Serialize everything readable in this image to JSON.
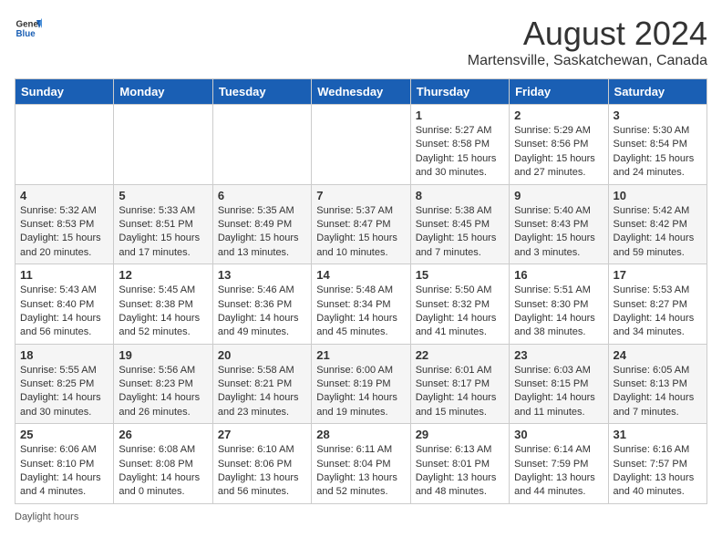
{
  "header": {
    "logo_general": "General",
    "logo_blue": "Blue",
    "month": "August 2024",
    "location": "Martensville, Saskatchewan, Canada"
  },
  "days_of_week": [
    "Sunday",
    "Monday",
    "Tuesday",
    "Wednesday",
    "Thursday",
    "Friday",
    "Saturday"
  ],
  "weeks": [
    [
      {
        "day": "",
        "info": ""
      },
      {
        "day": "",
        "info": ""
      },
      {
        "day": "",
        "info": ""
      },
      {
        "day": "",
        "info": ""
      },
      {
        "day": "1",
        "info": "Sunrise: 5:27 AM\nSunset: 8:58 PM\nDaylight: 15 hours and 30 minutes."
      },
      {
        "day": "2",
        "info": "Sunrise: 5:29 AM\nSunset: 8:56 PM\nDaylight: 15 hours and 27 minutes."
      },
      {
        "day": "3",
        "info": "Sunrise: 5:30 AM\nSunset: 8:54 PM\nDaylight: 15 hours and 24 minutes."
      }
    ],
    [
      {
        "day": "4",
        "info": "Sunrise: 5:32 AM\nSunset: 8:53 PM\nDaylight: 15 hours and 20 minutes."
      },
      {
        "day": "5",
        "info": "Sunrise: 5:33 AM\nSunset: 8:51 PM\nDaylight: 15 hours and 17 minutes."
      },
      {
        "day": "6",
        "info": "Sunrise: 5:35 AM\nSunset: 8:49 PM\nDaylight: 15 hours and 13 minutes."
      },
      {
        "day": "7",
        "info": "Sunrise: 5:37 AM\nSunset: 8:47 PM\nDaylight: 15 hours and 10 minutes."
      },
      {
        "day": "8",
        "info": "Sunrise: 5:38 AM\nSunset: 8:45 PM\nDaylight: 15 hours and 7 minutes."
      },
      {
        "day": "9",
        "info": "Sunrise: 5:40 AM\nSunset: 8:43 PM\nDaylight: 15 hours and 3 minutes."
      },
      {
        "day": "10",
        "info": "Sunrise: 5:42 AM\nSunset: 8:42 PM\nDaylight: 14 hours and 59 minutes."
      }
    ],
    [
      {
        "day": "11",
        "info": "Sunrise: 5:43 AM\nSunset: 8:40 PM\nDaylight: 14 hours and 56 minutes."
      },
      {
        "day": "12",
        "info": "Sunrise: 5:45 AM\nSunset: 8:38 PM\nDaylight: 14 hours and 52 minutes."
      },
      {
        "day": "13",
        "info": "Sunrise: 5:46 AM\nSunset: 8:36 PM\nDaylight: 14 hours and 49 minutes."
      },
      {
        "day": "14",
        "info": "Sunrise: 5:48 AM\nSunset: 8:34 PM\nDaylight: 14 hours and 45 minutes."
      },
      {
        "day": "15",
        "info": "Sunrise: 5:50 AM\nSunset: 8:32 PM\nDaylight: 14 hours and 41 minutes."
      },
      {
        "day": "16",
        "info": "Sunrise: 5:51 AM\nSunset: 8:30 PM\nDaylight: 14 hours and 38 minutes."
      },
      {
        "day": "17",
        "info": "Sunrise: 5:53 AM\nSunset: 8:27 PM\nDaylight: 14 hours and 34 minutes."
      }
    ],
    [
      {
        "day": "18",
        "info": "Sunrise: 5:55 AM\nSunset: 8:25 PM\nDaylight: 14 hours and 30 minutes."
      },
      {
        "day": "19",
        "info": "Sunrise: 5:56 AM\nSunset: 8:23 PM\nDaylight: 14 hours and 26 minutes."
      },
      {
        "day": "20",
        "info": "Sunrise: 5:58 AM\nSunset: 8:21 PM\nDaylight: 14 hours and 23 minutes."
      },
      {
        "day": "21",
        "info": "Sunrise: 6:00 AM\nSunset: 8:19 PM\nDaylight: 14 hours and 19 minutes."
      },
      {
        "day": "22",
        "info": "Sunrise: 6:01 AM\nSunset: 8:17 PM\nDaylight: 14 hours and 15 minutes."
      },
      {
        "day": "23",
        "info": "Sunrise: 6:03 AM\nSunset: 8:15 PM\nDaylight: 14 hours and 11 minutes."
      },
      {
        "day": "24",
        "info": "Sunrise: 6:05 AM\nSunset: 8:13 PM\nDaylight: 14 hours and 7 minutes."
      }
    ],
    [
      {
        "day": "25",
        "info": "Sunrise: 6:06 AM\nSunset: 8:10 PM\nDaylight: 14 hours and 4 minutes."
      },
      {
        "day": "26",
        "info": "Sunrise: 6:08 AM\nSunset: 8:08 PM\nDaylight: 14 hours and 0 minutes."
      },
      {
        "day": "27",
        "info": "Sunrise: 6:10 AM\nSunset: 8:06 PM\nDaylight: 13 hours and 56 minutes."
      },
      {
        "day": "28",
        "info": "Sunrise: 6:11 AM\nSunset: 8:04 PM\nDaylight: 13 hours and 52 minutes."
      },
      {
        "day": "29",
        "info": "Sunrise: 6:13 AM\nSunset: 8:01 PM\nDaylight: 13 hours and 48 minutes."
      },
      {
        "day": "30",
        "info": "Sunrise: 6:14 AM\nSunset: 7:59 PM\nDaylight: 13 hours and 44 minutes."
      },
      {
        "day": "31",
        "info": "Sunrise: 6:16 AM\nSunset: 7:57 PM\nDaylight: 13 hours and 40 minutes."
      }
    ]
  ],
  "footer": {
    "daylight_hours": "Daylight hours"
  }
}
